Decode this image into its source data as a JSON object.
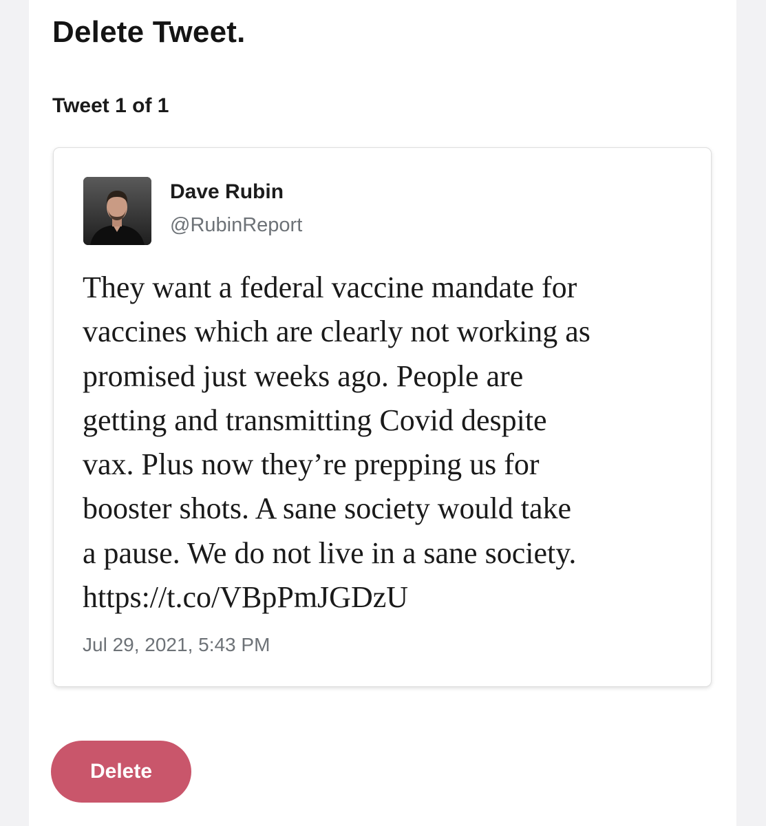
{
  "page": {
    "title": "Delete Tweet.",
    "counter": "Tweet 1 of 1"
  },
  "tweet": {
    "author_name": "Dave Rubin",
    "author_handle": "@RubinReport",
    "avatar_icon": "profile-photo",
    "text": "They want a federal vaccine mandate for\nvaccines which are clearly not working as\npromised just weeks ago. People are\ngetting and transmitting Covid despite\nvax. Plus now they’re prepping us for\nbooster shots. A sane society would take\na pause. We do not live in a sane society.\nhttps://t.co/VBpPmJGDzU",
    "timestamp": "Jul 29, 2021, 5:43 PM"
  },
  "actions": {
    "delete_label": "Delete"
  },
  "colors": {
    "delete_button": "#c9566b",
    "secondary_text": "#6d7277",
    "page_background": "#f2f2f4"
  }
}
